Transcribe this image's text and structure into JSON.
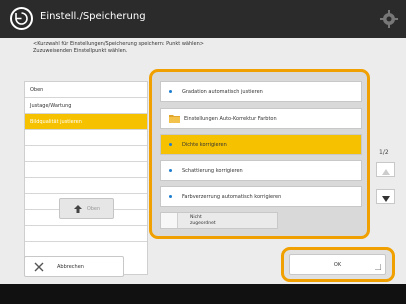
{
  "header": {
    "title": "Einstell./Speicherung"
  },
  "instruction": {
    "line1": "<Kurzwahl für Einstellungen/Speicherung speichern: Punkt wählen>",
    "line2": "Zuzuweisenden Einstellpunkt wählen."
  },
  "left_list": {
    "items": [
      {
        "label": "Oben",
        "selected": false
      },
      {
        "label": "Justage/Wartung",
        "selected": false
      },
      {
        "label": "Bildqualität justieren",
        "selected": true
      },
      {
        "label": "",
        "selected": false
      },
      {
        "label": "",
        "selected": false
      },
      {
        "label": "",
        "selected": false
      },
      {
        "label": "",
        "selected": false
      },
      {
        "label": "",
        "selected": false
      },
      {
        "label": "",
        "selected": false
      },
      {
        "label": "",
        "selected": false
      }
    ],
    "button_label": "Oben"
  },
  "options": [
    {
      "label": "Gradation automatisch justieren",
      "type": "dot",
      "selected": false
    },
    {
      "label": "Einstellungen Auto-Korrektur Farbton",
      "type": "folder",
      "selected": false
    },
    {
      "label": "Dichte korrigieren",
      "type": "dot",
      "selected": true
    },
    {
      "label": "Schattierung korrigieren",
      "type": "dot",
      "selected": false
    },
    {
      "label": "Farbverzerrung automatisch korrigieren",
      "type": "dot",
      "selected": false
    }
  ],
  "not_assigned": {
    "line1": "Nicht",
    "line2": "zugeordnet"
  },
  "pagination": {
    "page": "1/2"
  },
  "footer": {
    "cancel_label": "Abbrechen",
    "ok_label": "OK"
  },
  "colors": {
    "accent": "#f6c200",
    "highlight_frame": "#f0a000",
    "dot": "#1e7dd0"
  },
  "icons": {
    "back": "back-circle-icon",
    "settings": "gear-icon",
    "folder": "folder-icon",
    "cancel": "x-icon"
  }
}
